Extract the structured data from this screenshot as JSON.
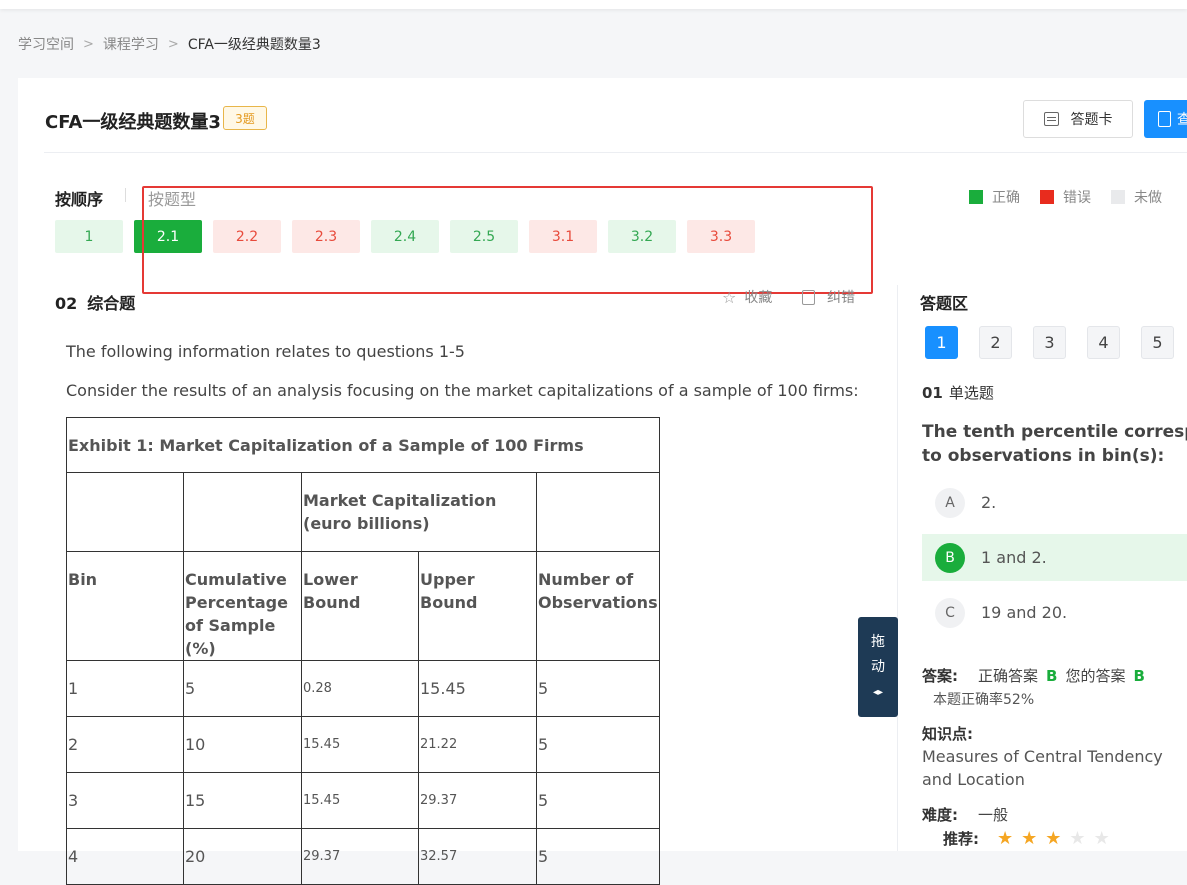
{
  "breadcrumb": {
    "items": [
      "学习空间",
      "课程学习",
      "CFA一级经典题数量3"
    ]
  },
  "header": {
    "title": "CFA一级经典题数量3",
    "count_badge": "3题",
    "answer_card_label": "答题卡",
    "blue_button_label": "查"
  },
  "tabs": {
    "by_order": "按顺序",
    "by_type": "按题型"
  },
  "legend": {
    "correct": "正确",
    "wrong": "错误",
    "undone": "未做",
    "colors": {
      "correct": "#1aad3c",
      "wrong": "#e82c1e",
      "undone": "#e9eaec"
    }
  },
  "question_nav": [
    {
      "label": "1",
      "status": "correct"
    },
    {
      "label": "2.1",
      "status": "active"
    },
    {
      "label": "2.2",
      "status": "wrong"
    },
    {
      "label": "2.3",
      "status": "wrong"
    },
    {
      "label": "2.4",
      "status": "correct"
    },
    {
      "label": "2.5",
      "status": "correct"
    },
    {
      "label": "3.1",
      "status": "wrong"
    },
    {
      "label": "3.2",
      "status": "correct"
    },
    {
      "label": "3.3",
      "status": "wrong"
    }
  ],
  "section": {
    "number": "02",
    "title": "综合题",
    "favorite_label": "收藏",
    "correction_label": "纠错"
  },
  "content": {
    "intro": "The following information relates to questions 1-5",
    "prompt": "Consider the results of an analysis focusing on the market capitalizations of a sample of 100 firms:"
  },
  "exhibit": {
    "title": "Exhibit 1: Market Capitalization of a Sample of 100 Firms",
    "group_header": "Market Capitalization (euro billions)",
    "columns": [
      "Bin",
      "Cumulative Percentage of Sample (%)",
      "Lower Bound",
      "Upper Bound",
      "Number of Observations"
    ],
    "rows": [
      [
        "1",
        "5",
        "0.28",
        "15.45",
        "5"
      ],
      [
        "2",
        "10",
        "15.45",
        "21.22",
        "5"
      ],
      [
        "3",
        "15",
        "15.45",
        "29.37",
        "5"
      ],
      [
        "4",
        "20",
        "29.37",
        "32.57",
        "5"
      ]
    ]
  },
  "drag_handle": {
    "line1": "拖",
    "line2": "动",
    "icon": "◂▸"
  },
  "answer_panel": {
    "title": "答题区",
    "numbers": [
      "1",
      "2",
      "3",
      "4",
      "5"
    ],
    "active_index": 0,
    "question_number": "01",
    "question_type": "单选题",
    "question_line1": "The tenth percentile correspond",
    "question_line2": "to observations in bin(s):",
    "options": [
      {
        "letter": "A",
        "text": "2.",
        "selected": false
      },
      {
        "letter": "B",
        "text": "1 and 2.",
        "selected": true
      },
      {
        "letter": "C",
        "text": "19 and 20.",
        "selected": false
      }
    ],
    "answer_label": "答案:",
    "correct_answer_label": "正确答案",
    "correct_answer": "B",
    "your_answer_label": "您的答案",
    "your_answer": "B",
    "accuracy": "本题正确率52%",
    "knowledge_label": "知识点:",
    "knowledge": "Measures of Central Tendency and Location",
    "difficulty_label": "难度:",
    "difficulty": "一般",
    "recommend_label": "推荐:",
    "recommend_stars": 3,
    "recommend_max": 5
  }
}
